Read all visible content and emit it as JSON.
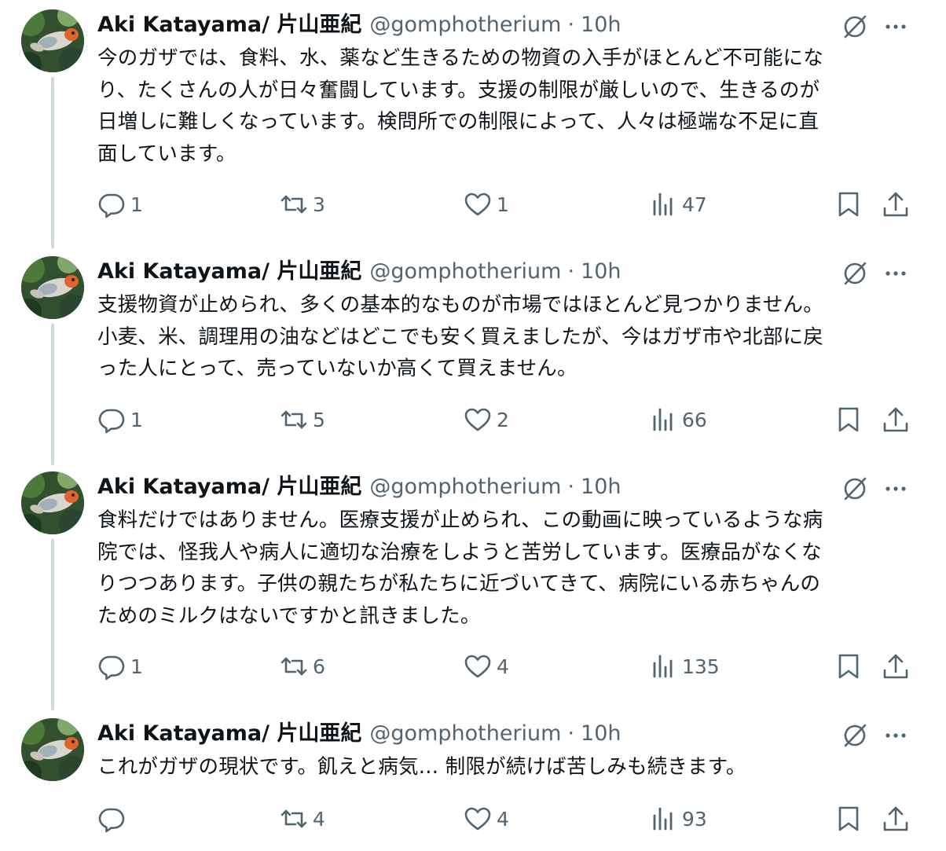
{
  "tweets": [
    {
      "author_name": "Aki Katayama/ 片山亜紀",
      "handle": "@gomphotherium",
      "separator": "·",
      "time": "10h",
      "lines": [
        "今のガザでは、食料、水、薬など生きるための物資の入手がほとんど不可能にな",
        "り、たくさんの人が日々奮闘しています。支援の制限が厳しいので、生きるのが",
        "日増しに難しくなっています。検問所での制限によって、人々は極端な不足に直",
        "面しています。"
      ],
      "replies": "1",
      "retweets": "3",
      "likes": "1",
      "views": "47"
    },
    {
      "author_name": "Aki Katayama/ 片山亜紀",
      "handle": "@gomphotherium",
      "separator": "·",
      "time": "10h",
      "lines": [
        "支援物資が止められ、多くの基本的なものが市場ではほとんど見つかりません。",
        "小麦、米、調理用の油などはどこでも安く買えましたが、今はガザ市や北部に戻",
        "った人にとって、売っていないか高くて買えません。"
      ],
      "replies": "1",
      "retweets": "5",
      "likes": "2",
      "views": "66"
    },
    {
      "author_name": "Aki Katayama/ 片山亜紀",
      "handle": "@gomphotherium",
      "separator": "·",
      "time": "10h",
      "lines": [
        "食料だけではありません。医療支援が止められ、この動画に映っているような病",
        "院では、怪我人や病人に適切な治療をしようと苦労しています。医療品がなくな",
        "りつつあります。子供の親たちが私たちに近づいてきて、病院にいる赤ちゃんの",
        "ためのミルクはないですかと訊きました。"
      ],
      "replies": "1",
      "retweets": "6",
      "likes": "4",
      "views": "135"
    },
    {
      "author_name": "Aki Katayama/ 片山亜紀",
      "handle": "@gomphotherium",
      "separator": "·",
      "time": "10h",
      "lines": [
        "これがガザの現状です。飢えと病気… 制限が続けば苦しみも続きます。"
      ],
      "replies": "",
      "retweets": "4",
      "likes": "4",
      "views": "93"
    }
  ],
  "colors": {
    "text_primary": "#0f1419",
    "text_secondary": "#536471",
    "thread_line": "#cfd9de",
    "background": "#ffffff"
  },
  "icons": {
    "reply": "reply-icon",
    "retweet": "retweet-icon",
    "like": "heart-icon",
    "views": "views-chart-icon",
    "bookmark": "bookmark-icon",
    "share": "share-icon",
    "grok": "grok-icon",
    "more": "more-icon"
  }
}
